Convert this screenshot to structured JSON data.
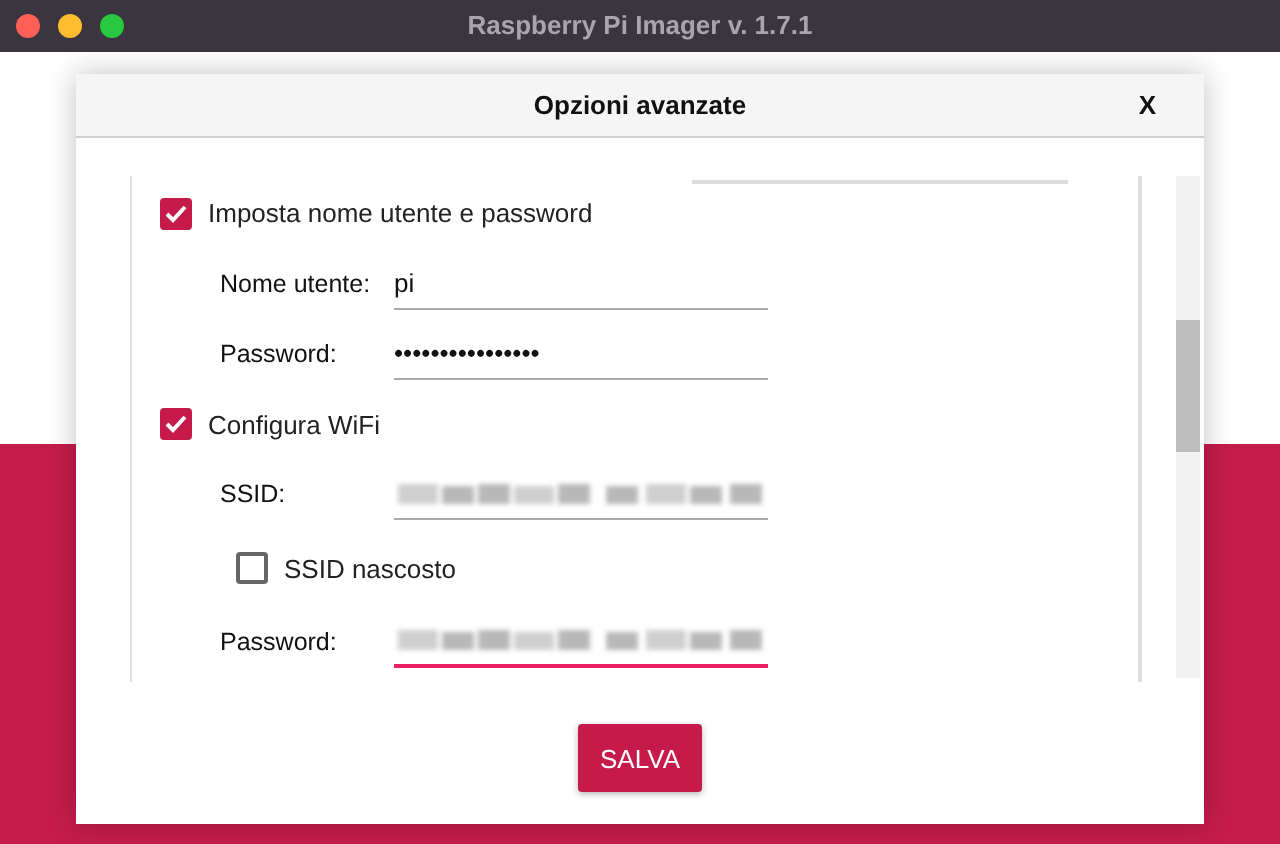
{
  "window": {
    "title": "Raspberry Pi Imager v. 1.7.1"
  },
  "dialog": {
    "title": "Opzioni avanzate",
    "close": "X"
  },
  "items": [
    {
      "kind": "checkbox",
      "label": "Imposta nome utente e password",
      "checked": true
    },
    {
      "kind": "field",
      "label": "Nome utente:",
      "value": "pi",
      "focused": false
    },
    {
      "kind": "field",
      "label": "Password:",
      "value": "••••••••••••••••",
      "focused": false
    },
    {
      "kind": "checkbox",
      "label": "Configura WiFi",
      "checked": true
    },
    {
      "kind": "field",
      "label": "SSID:",
      "blurred": true,
      "focused": false
    },
    {
      "kind": "sub_checkbox",
      "label": "SSID nascosto",
      "checked": false
    },
    {
      "kind": "field",
      "label": "Password:",
      "blurred": true,
      "focused": true
    }
  ],
  "save_button": "SALVA"
}
